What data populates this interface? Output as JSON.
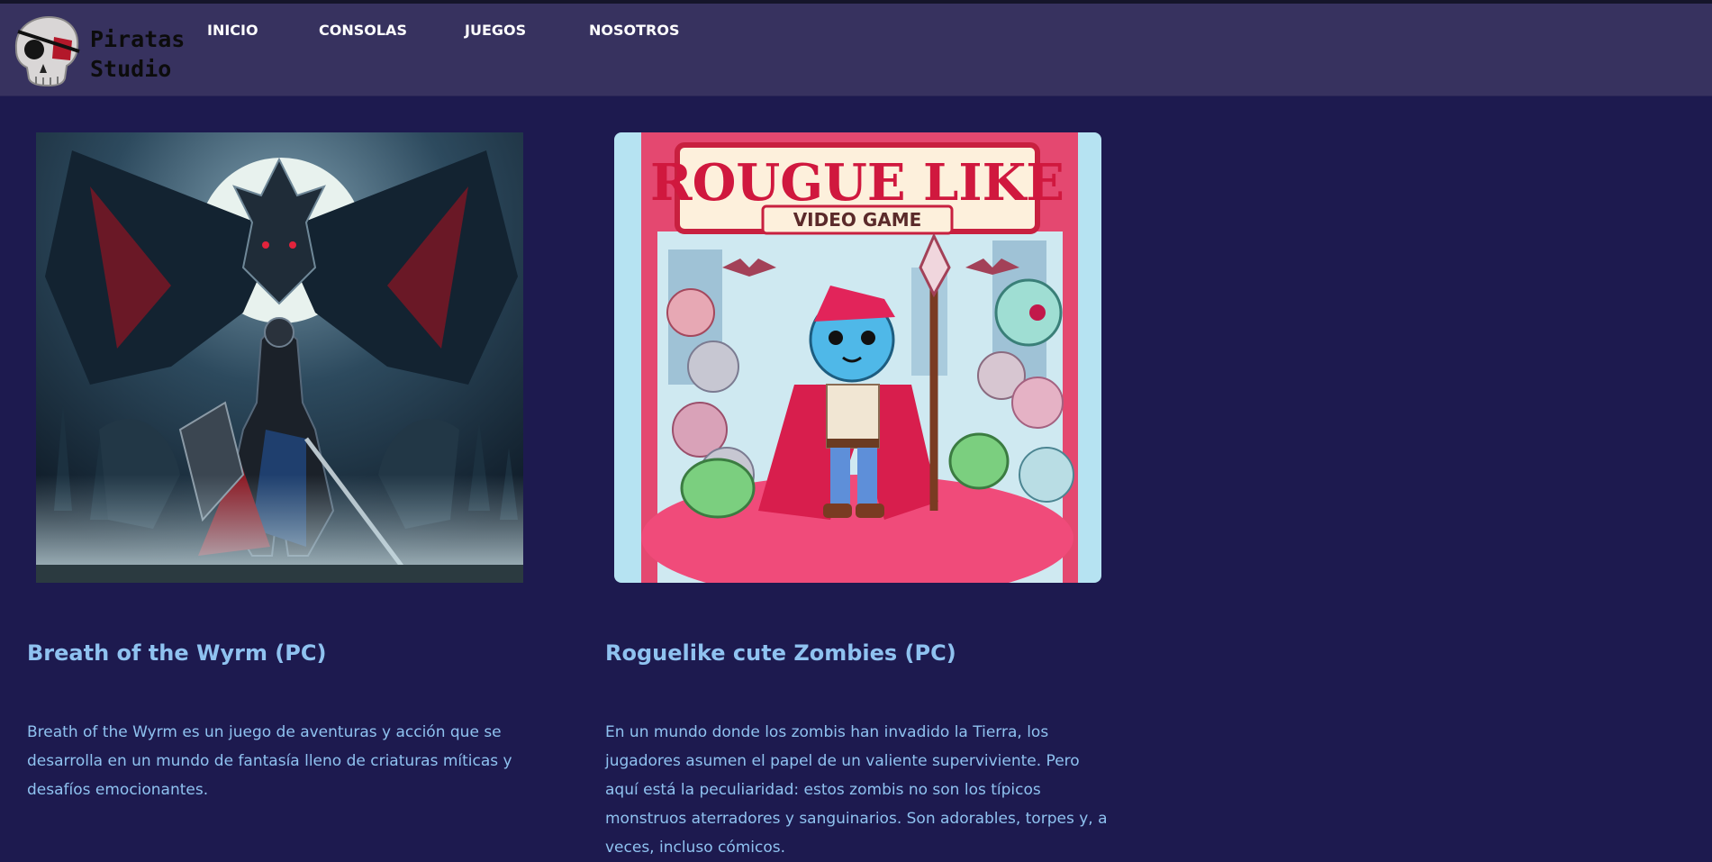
{
  "brand": {
    "name_line1": "Piratas",
    "name_line2": "Studio",
    "logo_icon": "skull-eyepatch-icon"
  },
  "nav": {
    "items": [
      {
        "label": "INICIO"
      },
      {
        "label": "CONSOLAS"
      },
      {
        "label": "JUEGOS"
      },
      {
        "label": "NOSOTROS"
      }
    ]
  },
  "games": [
    {
      "title": "Breath of the Wyrm (PC)",
      "description": "Breath of the Wyrm es un juego de aventuras y acción que se desarrolla en un mundo de fantasía lleno de criaturas míticas y desafíos emocionantes.",
      "image_alt": "Knight standing before a giant dragon under a full moon"
    },
    {
      "title": "Roguelike cute Zombies (PC)",
      "description": "En un mundo donde los zombis han invadido la Tierra, los jugadores asumen el papel de un valiente superviviente. Pero aquí está la peculiaridad: estos zombis no son los típicos monstruos aterradores y sanguinarios. Son adorables, torpes y, a veces, incluso cómicos.",
      "cover_title": "ROUGUE LIKE",
      "cover_subtitle": "VIDEO GAME"
    }
  ],
  "colors": {
    "page_bg": "#1d1a4f",
    "header_bg": "#37325f",
    "accent_text": "#8fc2f0",
    "nav_text": "#ffffff"
  }
}
